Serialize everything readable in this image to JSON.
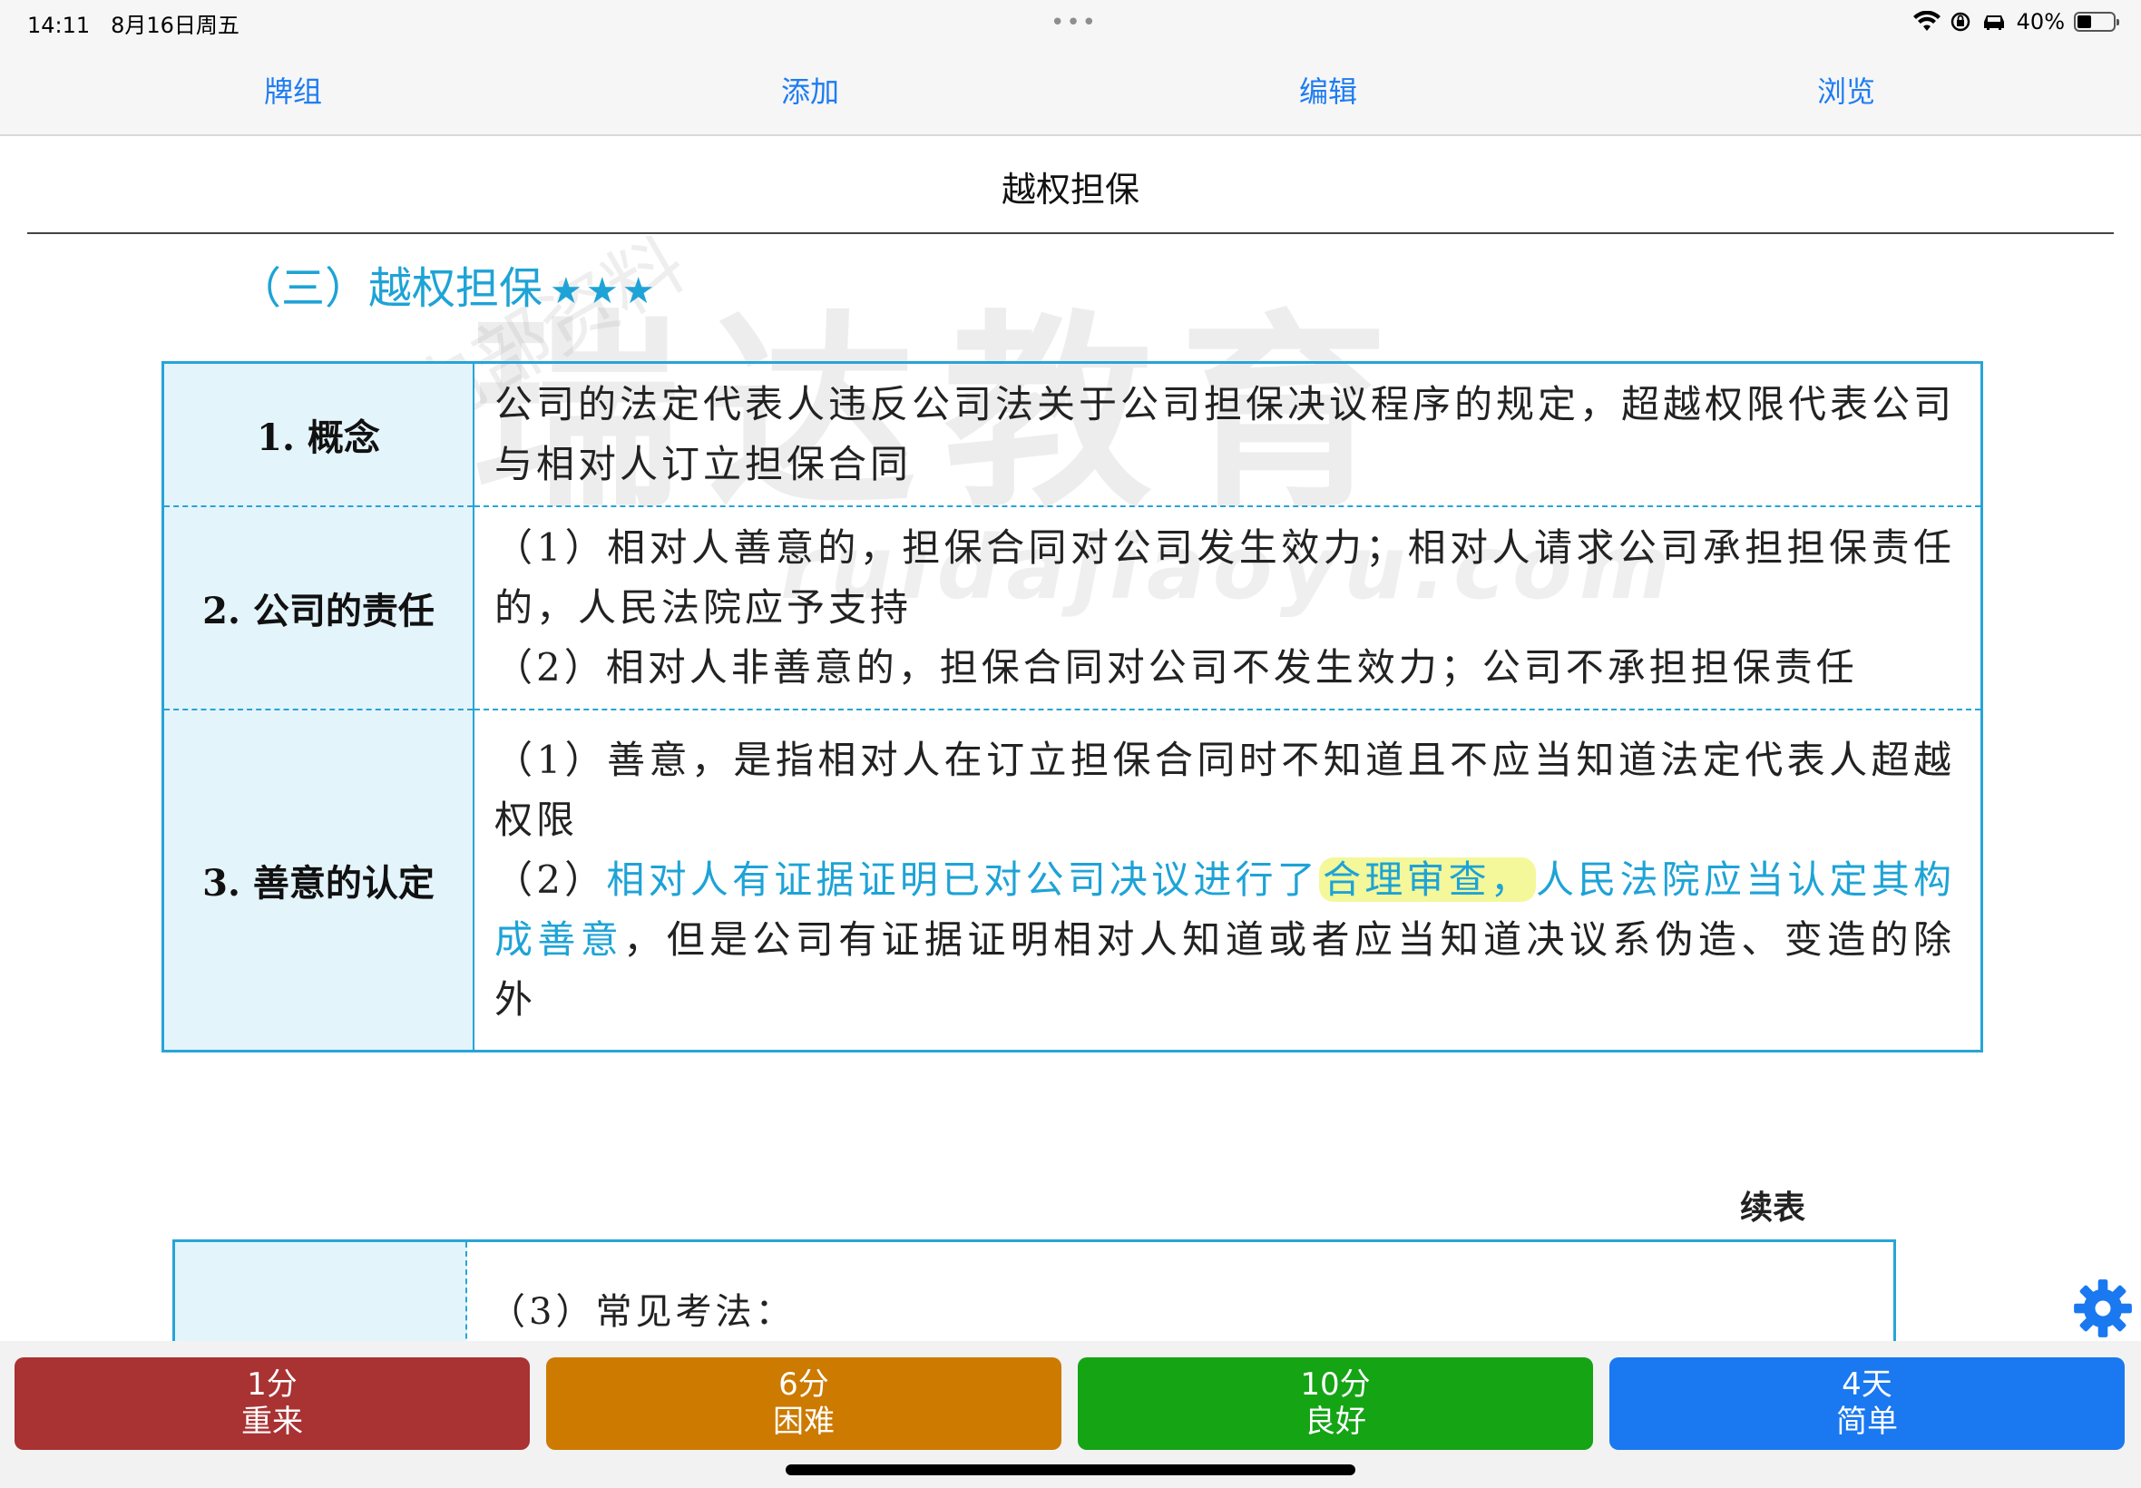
{
  "status_bar": {
    "time": "14:11",
    "date": "8月16日周五",
    "dots": "•••",
    "battery_text": "40%",
    "battery_level": 0.4
  },
  "toolbar": {
    "items": [
      "牌组",
      "添加",
      "编辑",
      "浏览"
    ],
    "color": "#1e7cf2"
  },
  "card": {
    "title": "越权担保",
    "section_heading": "（三）越权担保",
    "stars": "★★★",
    "rows": [
      {
        "term": "1. 概念",
        "desc": "公司的法定代表人违反公司法关于公司担保决议程序的规定，超越权限代表公司与相对人订立担保合同"
      },
      {
        "term": "2. 公司的责任",
        "desc1": "（1）相对人善意的，担保合同对公司发生效力；相对人请求公司承担担保责任的，人民法院应予支持",
        "desc2": "（2）相对人非善意的，担保合同对公司不发生效力；公司不承担担保责任"
      },
      {
        "term": "3. 善意的认定",
        "desc1": "（1）善意，是指相对人在订立担保合同时不知道且不应当知道法定代表人超越权限",
        "desc2_prefix": "（2）",
        "desc2_blue1": "相对人有证据证明已对公司决议进行了",
        "desc2_highlight": "合理审查，",
        "desc2_blue2": "人民法院应当认定其构成善意",
        "desc2_rest": "，但是公司有证据证明相对人知道或者应当知道决议系伪造、变造的除外"
      }
    ],
    "continued_label": "续表",
    "continued_row_text": "（3）常见考法：",
    "accent_color": "#27a4d7",
    "highlight_color": "#f0f578"
  },
  "watermark": {
    "main": "瑞达教育",
    "small": "内部资料",
    "url": "ruidajiaoyu.com"
  },
  "settings_icon": "gear-icon",
  "answer_buttons": [
    {
      "interval": "1分",
      "label": "重来",
      "color": "#a93232"
    },
    {
      "interval": "6分",
      "label": "困难",
      "color": "#cc7a00"
    },
    {
      "interval": "10分",
      "label": "良好",
      "color": "#14a414"
    },
    {
      "interval": "4天",
      "label": "简单",
      "color": "#1a78f0"
    }
  ]
}
